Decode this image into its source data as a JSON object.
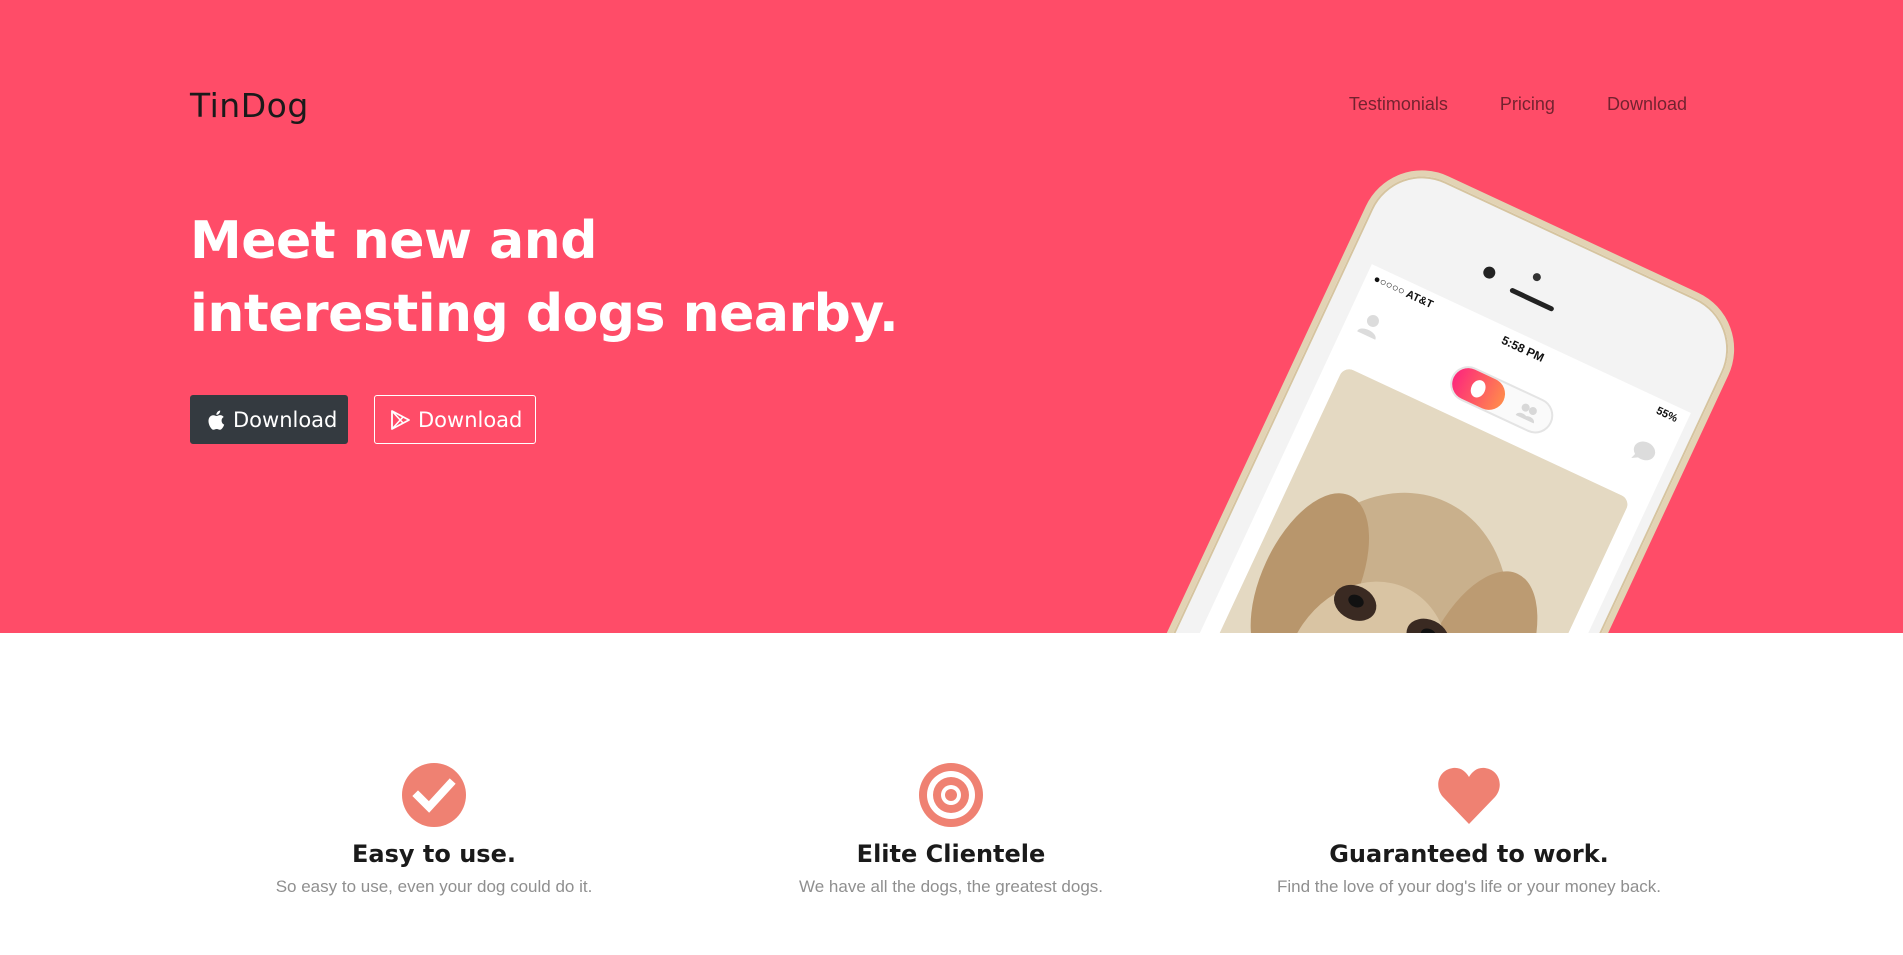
{
  "brand": {
    "name": "TinDog"
  },
  "nav": {
    "links": [
      {
        "label": "Testimonials"
      },
      {
        "label": "Pricing"
      },
      {
        "label": "Download"
      }
    ]
  },
  "hero": {
    "headline": "Meet new and interesting dogs nearby.",
    "buttons": [
      {
        "label": "Download",
        "icon": "apple-icon",
        "style": "dark"
      },
      {
        "label": "Download",
        "icon": "google-play-icon",
        "style": "outline"
      }
    ],
    "phone": {
      "carrier": "●○○○○ AT&T",
      "time": "5:58 PM",
      "battery": "55%"
    }
  },
  "features": [
    {
      "icon": "check-circle-icon",
      "title": "Easy to use.",
      "description": "So easy to use, even your dog could do it."
    },
    {
      "icon": "bullseye-icon",
      "title": "Elite Clientele",
      "description": "We have all the dogs, the greatest dogs."
    },
    {
      "icon": "heart-icon",
      "title": "Guaranteed to work.",
      "description": "Find the love of your dog's life or your money back."
    }
  ],
  "colors": {
    "hero_background": "#ff4c68",
    "feature_icon": "#ef8172",
    "dark_button": "#343a40"
  }
}
